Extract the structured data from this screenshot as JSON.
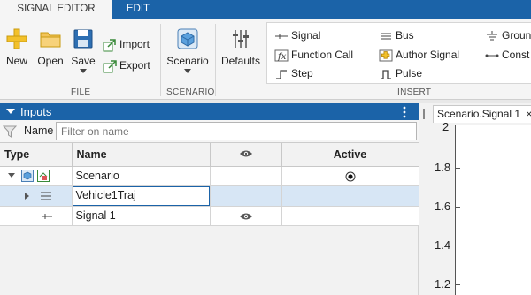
{
  "tabs": {
    "signal_editor": "SIGNAL EDITOR",
    "edit": "EDIT"
  },
  "ribbon": {
    "file": {
      "new": "New",
      "open": "Open",
      "save": "Save",
      "import": "Import",
      "export": "Export",
      "label": "FILE"
    },
    "scenario": {
      "scenario": "Scenario",
      "label": "SCENARIO"
    },
    "defaults": "Defaults",
    "insert": {
      "signal": "Signal",
      "function_call": "Function Call",
      "step": "Step",
      "bus": "Bus",
      "author_signal": "Author Signal",
      "pulse": "Pulse",
      "ground": "Groun",
      "constant": "Const",
      "label": "INSERT"
    }
  },
  "inputs_panel": {
    "title": "Inputs",
    "filter_label": "Name",
    "filter_placeholder": "Filter on name",
    "columns": {
      "type": "Type",
      "name": "Name",
      "active": "Active"
    },
    "rows": [
      {
        "name": "Scenario"
      },
      {
        "name": "Vehicle1Traj"
      },
      {
        "name": "Signal 1"
      }
    ]
  },
  "plot": {
    "tab_title": "Scenario.Signal 1",
    "close_glyph": "×",
    "yticks": [
      "2",
      "1.8",
      "1.6",
      "1.4",
      "1.2"
    ]
  },
  "colors": {
    "accent": "#1b63a8",
    "selected_row": "#d7e6f5"
  }
}
